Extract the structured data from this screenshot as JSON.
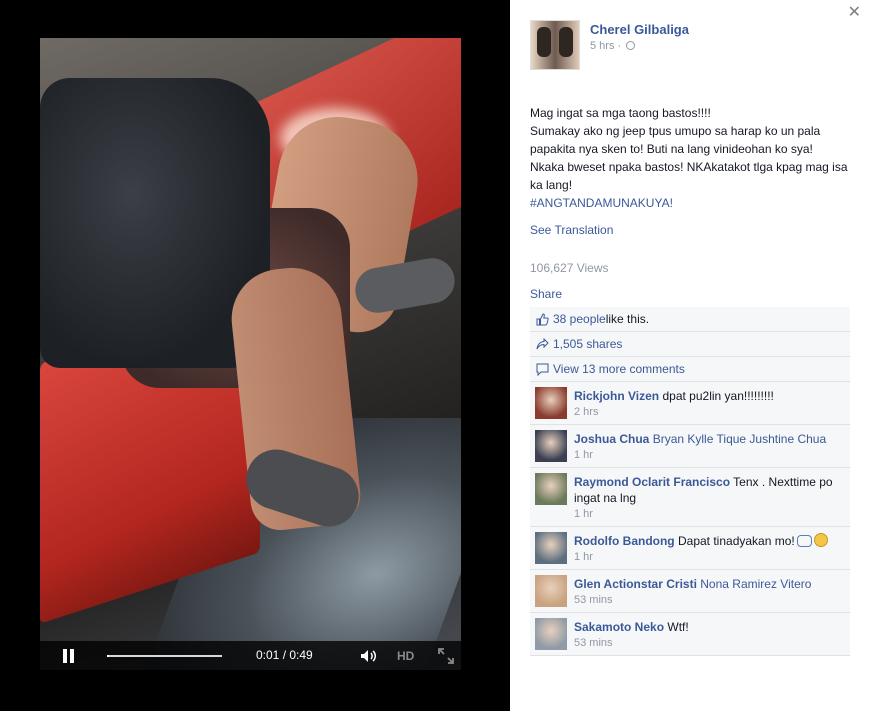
{
  "video": {
    "current_time": "0:01",
    "separator": " / ",
    "duration": "0:49",
    "progress": 0.02,
    "hd_label": "HD"
  },
  "post": {
    "author": "Cherel Gilbaliga",
    "time": "5 hrs ·",
    "text_lines": [
      "Mag ingat sa mga taong bastos!!!!",
      "Sumakay ako ng jeep tpus umupo sa harap ko un pala papakita nya sken to! Buti na lang vinideohan ko sya!",
      "Nkaka bweset npaka bastos! NKAkatakot tlga kpag mag isa ka lang!"
    ],
    "hashtag": "#ANGTANDAMUNAKUYA!",
    "see_translation": "See Translation",
    "views": "106,627 Views",
    "share": "Share"
  },
  "ufi": {
    "likes_link": "38 people",
    "likes_suffix": " like this.",
    "shares": "1,505 shares",
    "more_comments": "View 13 more comments"
  },
  "comments": [
    {
      "name": "Rickjohn Vizen",
      "text": "dpat pu2lin yan!!!!!!!!!",
      "tag": "",
      "time": "2 hrs",
      "avatar_color": "#8a3b2e"
    },
    {
      "name": "Joshua Chua",
      "text": "",
      "tag": "Bryan Kylle Tique Jushtine Chua",
      "time": "1 hr",
      "avatar_color": "#3a3f52"
    },
    {
      "name": "Raymond Oclarit Francisco",
      "text": "Tenx . Nexttime po ingat na lng",
      "tag": "",
      "time": "1 hr",
      "avatar_color": "#6b7a5a"
    },
    {
      "name": "Rodolfo Bandong",
      "text": "Dapat tinadyakan mo!",
      "tag": "",
      "time": "1 hr",
      "avatar_color": "#5d6f7f"
    },
    {
      "name": "Glen Actionstar Cristi",
      "text": "",
      "tag": "Nona Ramirez Vitero",
      "time": "53 mins",
      "avatar_color": "#c9a27f"
    },
    {
      "name": "Sakamoto Neko",
      "text": "Wtf!",
      "tag": "",
      "time": "53 mins",
      "avatar_color": "#8f9ba6"
    }
  ],
  "colors": {
    "link": "#3b5998",
    "meta": "#9197a3",
    "ufi_bg": "#f6f7f8"
  }
}
